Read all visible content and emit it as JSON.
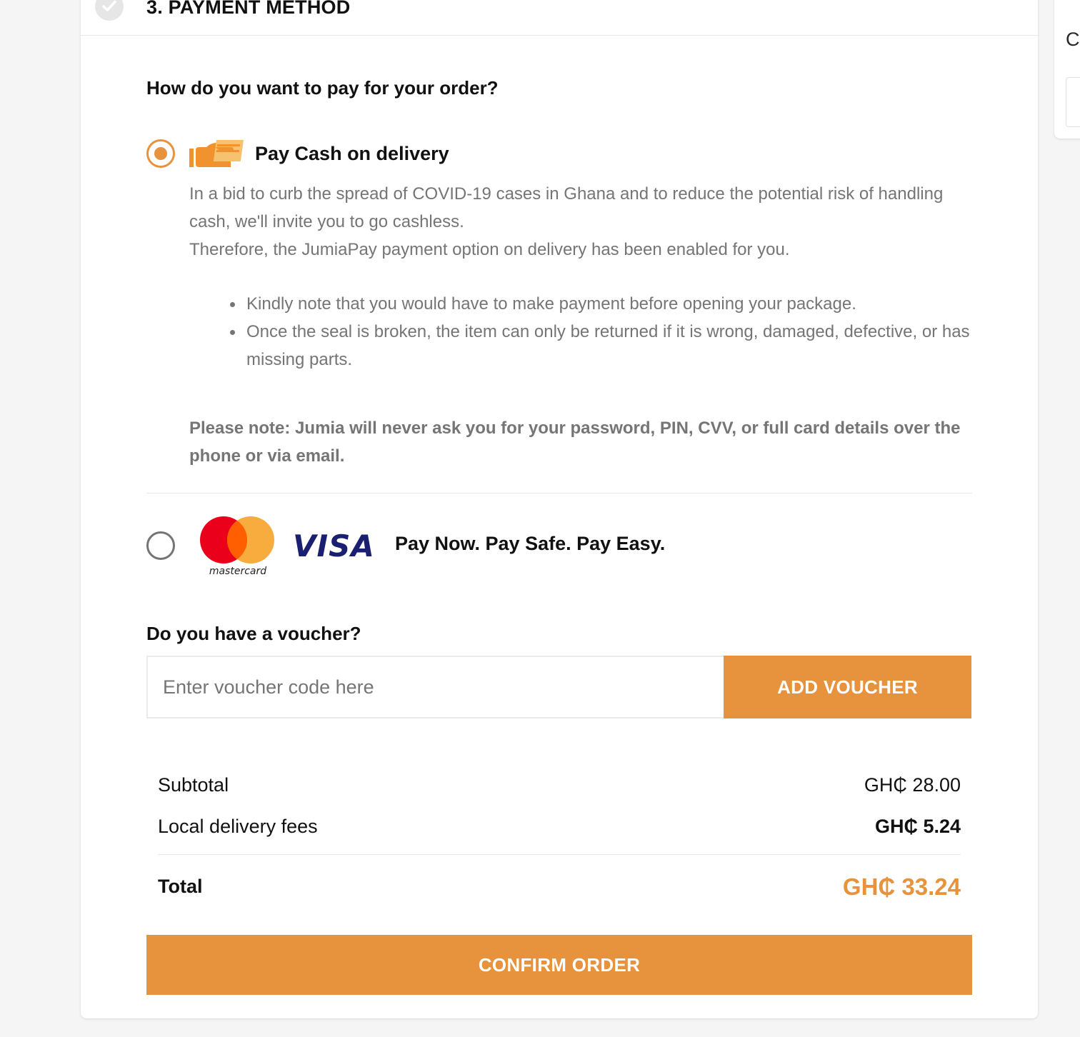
{
  "step": {
    "title": "3. PAYMENT METHOD"
  },
  "payment": {
    "question": "How do you want to pay for your order?",
    "options": [
      {
        "label": "Pay Cash on delivery",
        "selected": true,
        "icon": "cash-hand-icon",
        "description_lines": [
          "In a bid to curb the spread of COVID-19 cases in Ghana and to reduce the potential risk of handling cash, we'll invite you to go cashless.",
          "Therefore, the JumiaPay payment option on delivery has been enabled for you."
        ],
        "bullets": [
          "Kindly note that you would have to make payment before opening your package.",
          "Once the seal is broken, the item can only be returned if it is wrong, damaged, defective, or has missing parts."
        ],
        "note": "Please note: Jumia will never ask you for your password, PIN, CVV, or full card details over the phone or via email."
      },
      {
        "label": "Pay Now. Pay Safe. Pay Easy.",
        "selected": false,
        "logos": {
          "mastercard_text": "mastercard",
          "visa_text": "VISA"
        }
      }
    ]
  },
  "voucher": {
    "question": "Do you have a voucher?",
    "placeholder": "Enter voucher code here",
    "button_label": "ADD VOUCHER"
  },
  "summary": {
    "subtotal_label": "Subtotal",
    "subtotal_value": "GH₵ 28.00",
    "delivery_label": "Local delivery fees",
    "delivery_value": "GH₵ 5.24",
    "total_label": "Total",
    "total_value": "GH₵ 33.24"
  },
  "confirm_button": "CONFIRM ORDER",
  "side_panel": {
    "letter": "C"
  },
  "colors": {
    "accent": "#e7923d",
    "muted_text": "#757575",
    "visa_blue": "#1a1f71",
    "mastercard_red": "#eb001b",
    "mastercard_orange": "#f79e1b"
  }
}
